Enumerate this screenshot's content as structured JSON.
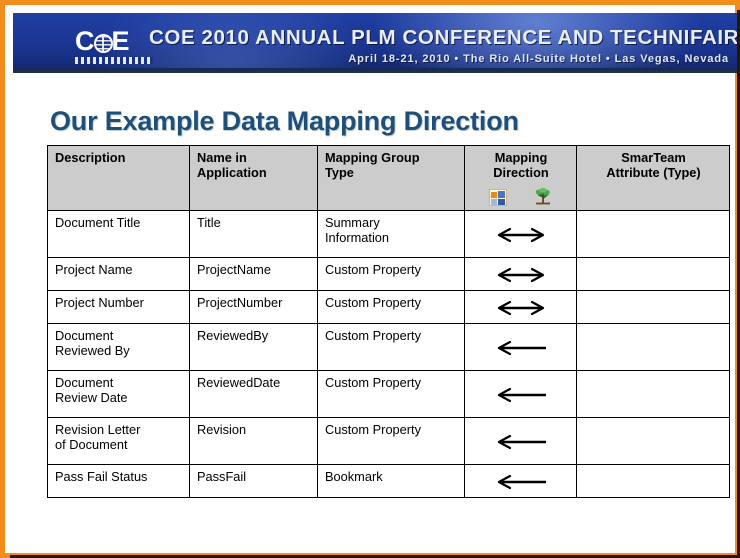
{
  "banner": {
    "logo_text_left": "C",
    "logo_globe": "globe-icon",
    "logo_text_right": "E",
    "title": "COE 2010 ANNUAL PLM CONFERENCE AND TECHNIFAIR",
    "subtitle": "April 18-21, 2010  •  The Rio All-Suite Hotel  •  Las Vegas, Nevada",
    "background_color": "#16308a",
    "frame_color": "#F28C1B"
  },
  "slide": {
    "title": "Our Example Data Mapping Direction",
    "title_color": "#1F4E79"
  },
  "table": {
    "header_background": "#cccccc",
    "columns": [
      {
        "label": "Description"
      },
      {
        "label": "Name in\nApplication",
        "line1": "Name in",
        "line2": "Application"
      },
      {
        "label": "Mapping Group\nType",
        "line1": "Mapping Group",
        "line2": "Type"
      },
      {
        "label": "Mapping\nDirection",
        "line1": "Mapping",
        "line2": "Direction",
        "icons": [
          "office-document-icon",
          "smarteam-tree-icon"
        ]
      },
      {
        "label": "SmarTeam\nAttribute (Type)",
        "line1": "SmarTeam",
        "line2": "Attribute (Type)"
      }
    ],
    "rows": [
      {
        "description": "Document Title",
        "name_in_application": "Title",
        "mapping_group_type": "Summary Information",
        "mapping_group_type_l1": "Summary",
        "mapping_group_type_l2": "Information",
        "mapping_direction": "bidirectional",
        "smarteam_attribute": ""
      },
      {
        "description": "Project Name",
        "name_in_application": "ProjectName",
        "mapping_group_type": "Custom Property",
        "mapping_group_type_l1": "Custom Property",
        "mapping_group_type_l2": "",
        "mapping_direction": "bidirectional",
        "smarteam_attribute": ""
      },
      {
        "description": "Project Number",
        "name_in_application": "ProjectNumber",
        "mapping_group_type": "Custom Property",
        "mapping_group_type_l1": "Custom Property",
        "mapping_group_type_l2": "",
        "mapping_direction": "bidirectional",
        "smarteam_attribute": ""
      },
      {
        "description": "Document Reviewed By",
        "description_l1": "Document",
        "description_l2": "Reviewed By",
        "name_in_application": "ReviewedBy",
        "mapping_group_type": "Custom Property",
        "mapping_group_type_l1": "Custom Property",
        "mapping_group_type_l2": "",
        "mapping_direction": "left",
        "smarteam_attribute": ""
      },
      {
        "description": "Document Review Date",
        "description_l1": "Document",
        "description_l2": "Review Date",
        "name_in_application": "ReviewedDate",
        "mapping_group_type": "Custom Property",
        "mapping_group_type_l1": "Custom Property",
        "mapping_group_type_l2": "",
        "mapping_direction": "left",
        "smarteam_attribute": ""
      },
      {
        "description": "Revision Letter of Document",
        "description_l1": "Revision Letter",
        "description_l2": "of Document",
        "name_in_application": "Revision",
        "mapping_group_type": "Custom Property",
        "mapping_group_type_l1": "Custom Property",
        "mapping_group_type_l2": "",
        "mapping_direction": "left",
        "smarteam_attribute": ""
      },
      {
        "description": "Pass Fail Status",
        "description_l1": "Pass Fail Status",
        "description_l2": "",
        "name_in_application": "PassFail",
        "mapping_group_type": "Bookmark",
        "mapping_group_type_l1": "Bookmark",
        "mapping_group_type_l2": "",
        "mapping_direction": "left",
        "smarteam_attribute": ""
      }
    ]
  }
}
